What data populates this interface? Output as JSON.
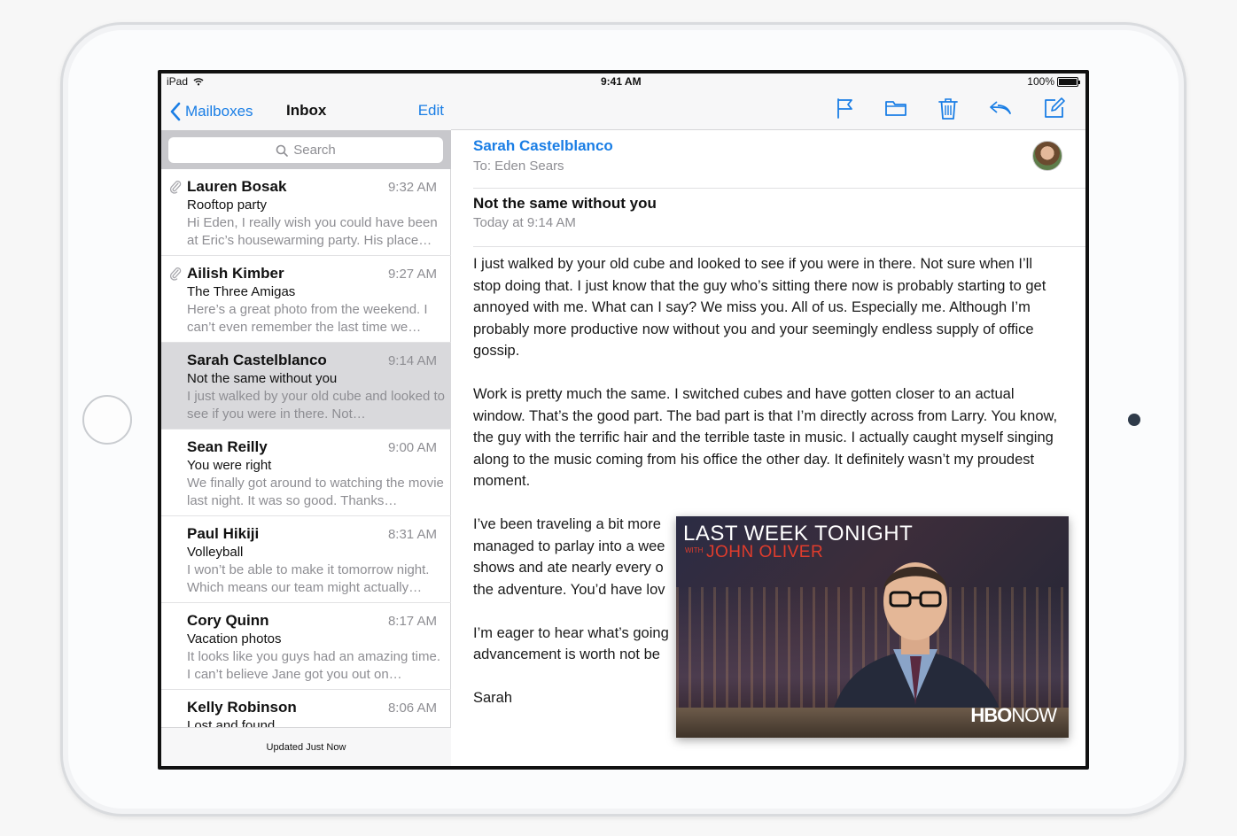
{
  "status_bar": {
    "device": "iPad",
    "time": "9:41 AM",
    "battery": "100%"
  },
  "left_nav": {
    "back_label": "Mailboxes",
    "title": "Inbox",
    "edit_label": "Edit"
  },
  "search": {
    "placeholder": "Search"
  },
  "messages": [
    {
      "sender": "Lauren Bosak",
      "time": "9:32 AM",
      "subject": "Rooftop party",
      "preview": "Hi Eden, I really wish you could have been at Eric’s housewarming party. His place…",
      "attachment": true
    },
    {
      "sender": "Ailish Kimber",
      "time": "9:27 AM",
      "subject": "The Three Amigas",
      "preview": "Here’s a great photo from the weekend. I can’t even remember the last time we…",
      "attachment": true
    },
    {
      "sender": "Sarah Castelblanco",
      "time": "9:14 AM",
      "subject": "Not the same without you",
      "preview": "I just walked by your old cube and looked to see if you were in there. Not…",
      "attachment": false
    },
    {
      "sender": "Sean Reilly",
      "time": "9:00 AM",
      "subject": "You were right",
      "preview": "We finally got around to watching the movie last night. It was so good. Thanks…",
      "attachment": false
    },
    {
      "sender": "Paul Hikiji",
      "time": "8:31 AM",
      "subject": "Volleyball",
      "preview": "I won’t be able to make it tomorrow night. Which means our team might actually…",
      "attachment": false
    },
    {
      "sender": "Cory Quinn",
      "time": "8:17 AM",
      "subject": "Vacation photos",
      "preview": "It looks like you guys had an amazing time. I can’t believe Jane got you out on…",
      "attachment": false
    },
    {
      "sender": "Kelly Robinson",
      "time": "8:06 AM",
      "subject": "Lost and found",
      "preview": "",
      "attachment": false
    }
  ],
  "footer": {
    "status": "Updated Just Now"
  },
  "toolbar_icons": [
    "flag-icon",
    "folder-icon",
    "trash-icon",
    "reply-icon",
    "compose-icon"
  ],
  "email": {
    "from": "Sarah Castelblanco",
    "to": "To: Eden Sears",
    "subject": "Not the same without you",
    "date": "Today at 9:14 AM",
    "paragraphs": [
      "I just walked by your old cube and looked to see if you were in there. Not sure when I’ll stop doing that. I just know that the guy who’s sitting there now is probably starting to get annoyed with me. What can I say? We miss you. All of us. Especially me. Although I’m probably more productive now without you and your seemingly endless supply of office gossip.",
      "Work is pretty much the same. I switched cubes and have gotten closer to an actual window. That’s the good part. The bad part is that I’m directly across from Larry. You know, the guy with the terrific hair and the terrible taste in music. I actually caught myself singing along to the music coming from his office the other day. It definitely wasn’t my proudest moment.",
      "I’ve been traveling a bit more managed to parlay into a wee shows and ate nearly every o the adventure. You’d have lov",
      "I’m eager to hear what’s going advancement is worth not be",
      "Sarah"
    ]
  },
  "pip": {
    "title_line1": "LAST WEEK TONIGHT",
    "with": "WITH",
    "title_line2": "JOHN OLIVER",
    "logo_bold": "HBO",
    "logo_light": "NOW"
  },
  "colors": {
    "accent": "#1a7ee5",
    "selected_row": "#d9d9dc"
  }
}
